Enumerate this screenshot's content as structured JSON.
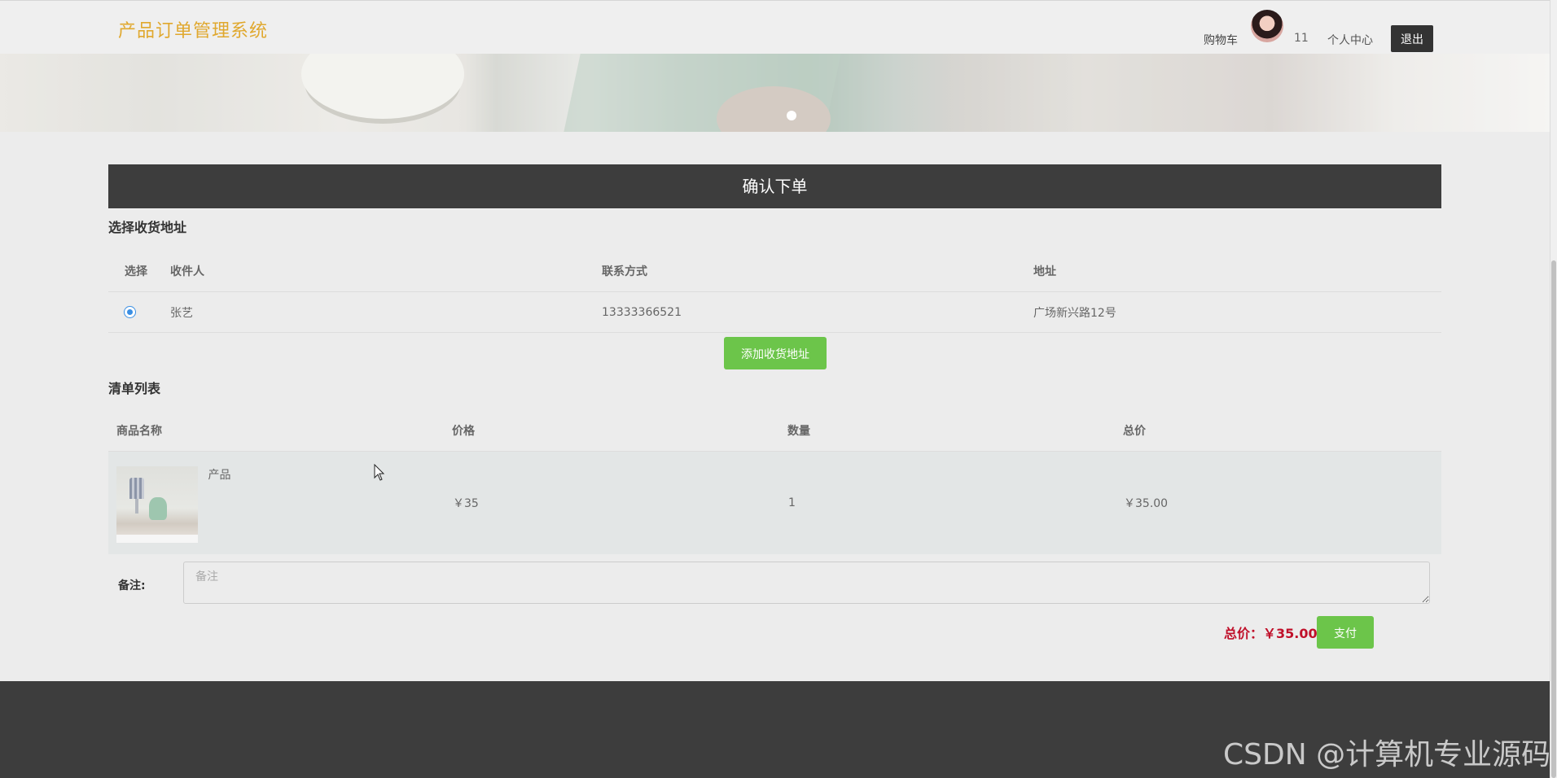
{
  "header": {
    "brand": "产品订单管理系统",
    "cart": "购物车",
    "count": "11",
    "user_center": "个人中心",
    "logout": "退出"
  },
  "page_title": "确认下单",
  "address": {
    "section_title": "选择收货地址",
    "columns": [
      "选择",
      "收件人",
      "联系方式",
      "地址"
    ],
    "rows": [
      {
        "selected": true,
        "name": "张艺",
        "phone": "13333366521",
        "address": "广场新兴路12号"
      }
    ],
    "add_button": "添加收货地址"
  },
  "list": {
    "section_title": "清单列表",
    "columns": [
      "商品名称",
      "价格",
      "数量",
      "总价"
    ],
    "items": [
      {
        "name": "产品",
        "price": "￥35",
        "quantity": "1",
        "total": "￥35.00"
      }
    ]
  },
  "note": {
    "label": "备注:",
    "placeholder": "备注"
  },
  "summary": {
    "total": "总价：￥35.00",
    "pay_button": "支付"
  },
  "watermark": "CSDN @计算机专业源码",
  "colors": {
    "brand": "#e0a82e",
    "accent_green": "#6cc54a",
    "total_red": "#c0102a",
    "dark_bar": "#3d3d3d"
  }
}
